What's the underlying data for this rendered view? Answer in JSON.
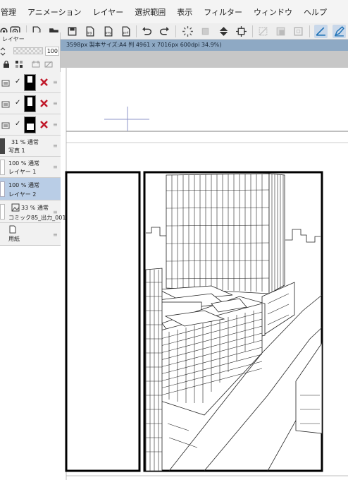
{
  "menu": [
    "管理",
    "アニメーション",
    "レイヤー",
    "選択範囲",
    "表示",
    "フィルター",
    "ウィンドウ",
    "ヘルプ"
  ],
  "docbar": {
    "text": "3598px 製本サイズ:A4 判 4961 x 7016px 600dpi 34.9%)"
  },
  "layer_panel": {
    "title": "レイヤー",
    "opacity": "100",
    "layers": [
      {
        "line1": "31 % 通常",
        "line2": "写真 1"
      },
      {
        "line1": "100 % 通常",
        "line2": "レイヤー 1"
      },
      {
        "line1": "100 % 通常",
        "line2": "レイヤー 2"
      },
      {
        "line1": "33 % 通常",
        "line2": "コミック85_出力_001"
      },
      {
        "line2": "用紙"
      }
    ]
  },
  "colors": {
    "docbar": "#8ea9c4",
    "selected_layer": "#b9cde6",
    "panel": "#f1f1f1"
  }
}
